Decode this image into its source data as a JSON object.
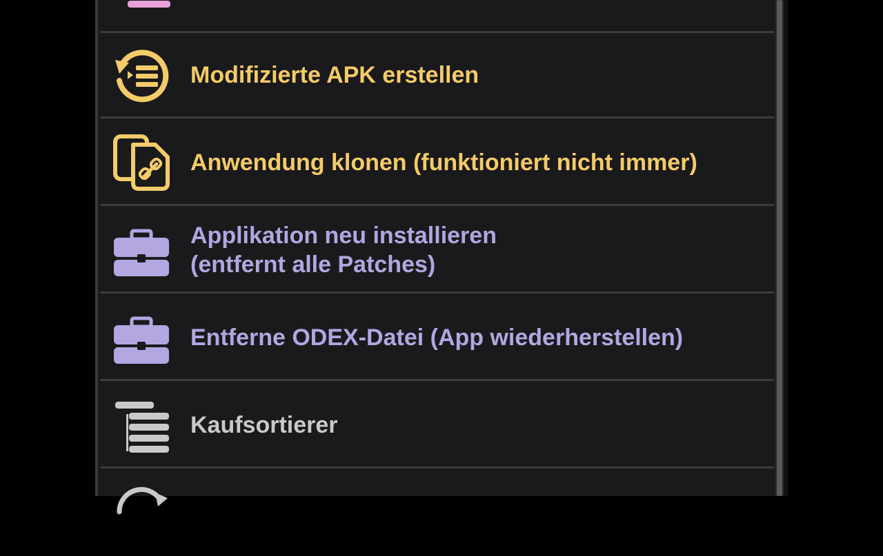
{
  "menu": {
    "items": [
      {
        "label": "",
        "icon": "sort-bars-pink-icon",
        "color": "#e8a0d8"
      },
      {
        "label": "Modifizierte APK erstellen",
        "icon": "rebuild-list-icon",
        "color": "#f4cb6a"
      },
      {
        "label": "Anwendung klonen (funktioniert nicht immer)",
        "icon": "clone-files-link-icon",
        "color": "#f4cb6a"
      },
      {
        "label_line1": "Applikation neu installieren",
        "label_line2": "(entfernt alle Patches)",
        "icon": "toolbox-icon",
        "color": "#b3a6e1"
      },
      {
        "label": "Entferne ODEX-Datei (App wiederherstellen)",
        "icon": "toolbox-icon",
        "color": "#b3a6e1"
      },
      {
        "label": "Kaufsortierer",
        "icon": "sort-bars-icon",
        "color": "#c9c9c9"
      },
      {
        "label": "",
        "icon": "refresh-icon",
        "color": "#c9c9c9"
      }
    ]
  }
}
